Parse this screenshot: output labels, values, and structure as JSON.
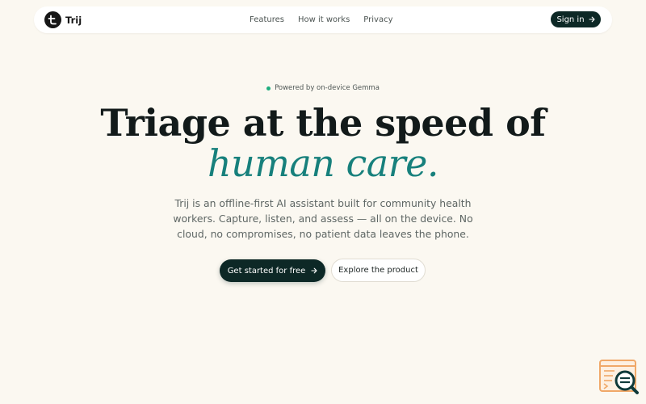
{
  "nav": {
    "brand_name": "Trij",
    "links": [
      "Features",
      "How it works",
      "Privacy"
    ],
    "signin_label": "Sign in"
  },
  "hero": {
    "badge": "Powered by on-device Gemma",
    "headline_line1": "Triage at the speed of",
    "headline_line2": "human care.",
    "subtext": "Trij is an offline-first AI assistant built for community health workers. Capture, listen, and assess — all on the device. No cloud, no compromises, no patient data leaves the phone.",
    "primary_cta": "Get started for free",
    "secondary_cta": "Explore the product"
  },
  "colors": {
    "background": "#fbf8f1",
    "primary": "#0d2826",
    "accent": "#17807c",
    "badge_dot": "#1fae7f",
    "widget_orange": "#f0a868",
    "widget_teal": "#0f3a3a"
  },
  "icons": {
    "brand": "brand-mark-icon",
    "signin": "arrow-right-icon",
    "primary_cta": "arrow-right-icon",
    "widget": "search-feedback-icon"
  }
}
